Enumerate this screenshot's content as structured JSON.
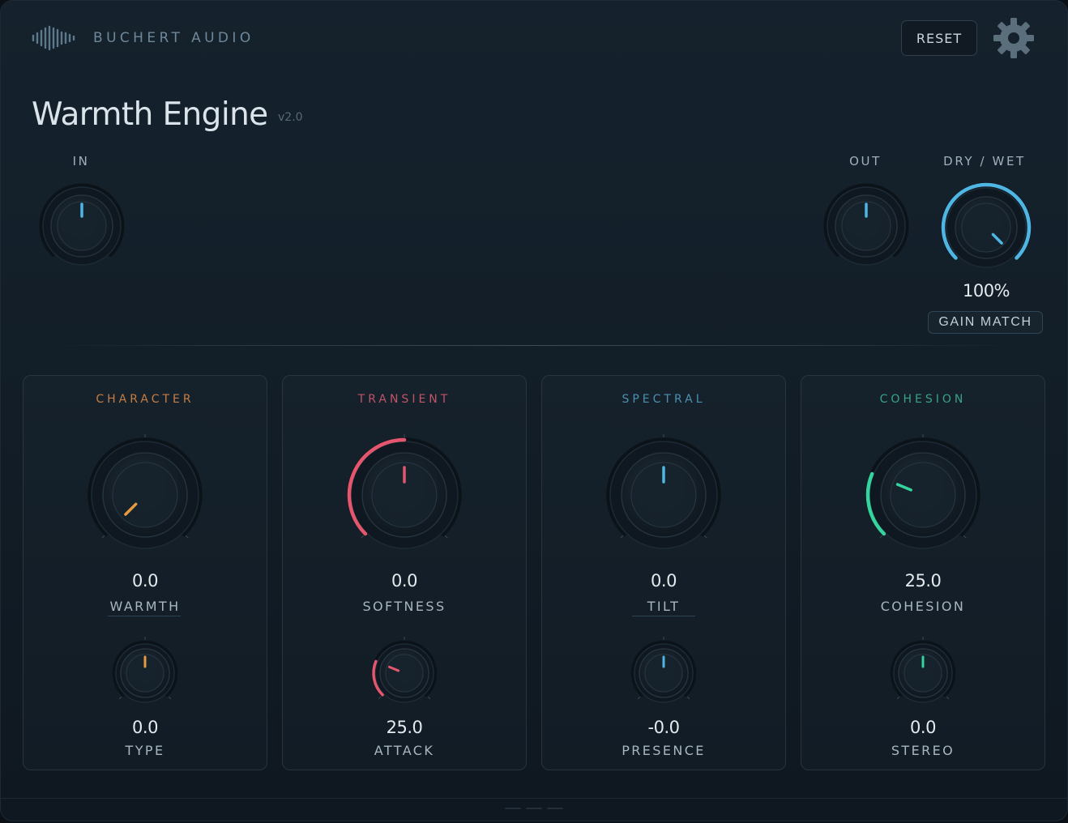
{
  "header": {
    "brand": "BUCHERT AUDIO",
    "reset_label": "RESET",
    "logo_icon": "waveform-icon",
    "settings_icon": "gear-icon"
  },
  "plugin": {
    "title": "Warmth Engine",
    "version": "v2.0"
  },
  "io": {
    "input": {
      "label": "IN",
      "value": 0.5
    },
    "output": {
      "label": "OUT",
      "value": 0.5
    },
    "drywet": {
      "label": "DRY / WET",
      "value_text": "100%",
      "value": 1.0
    },
    "gain_match_label": "GAIN MATCH"
  },
  "colors": {
    "accent": "#4fb6e3",
    "character": "#e79a3f",
    "transient": "#e4566e",
    "spectral": "#4fb6e3",
    "cohesion": "#35d39d"
  },
  "panels": [
    {
      "title": "CHARACTER",
      "title_color": "#c67d45",
      "big": {
        "label": "WARMTH",
        "value_text": "0.0",
        "value": 0.0
      },
      "small": {
        "label": "TYPE",
        "value_text": "0.0",
        "value": 0.5
      }
    },
    {
      "title": "TRANSIENT",
      "title_color": "#c25467",
      "big": {
        "label": "SOFTNESS",
        "value_text": "0.0",
        "value": 0.5
      },
      "small": {
        "label": "ATTACK",
        "value_text": "25.0",
        "value": 0.25
      }
    },
    {
      "title": "SPECTRAL",
      "title_color": "#4c90b1",
      "big": {
        "label": "TILT",
        "value_text": "0.0",
        "value": 0.5
      },
      "small": {
        "label": "PRESENCE",
        "value_text": "-0.0",
        "value": 0.5
      }
    },
    {
      "title": "COHESION",
      "title_color": "#3aa386",
      "big": {
        "label": "COHESION",
        "value_text": "25.0",
        "value": 0.25
      },
      "small": {
        "label": "STEREO",
        "value_text": "0.0",
        "value": 0.5
      }
    }
  ]
}
